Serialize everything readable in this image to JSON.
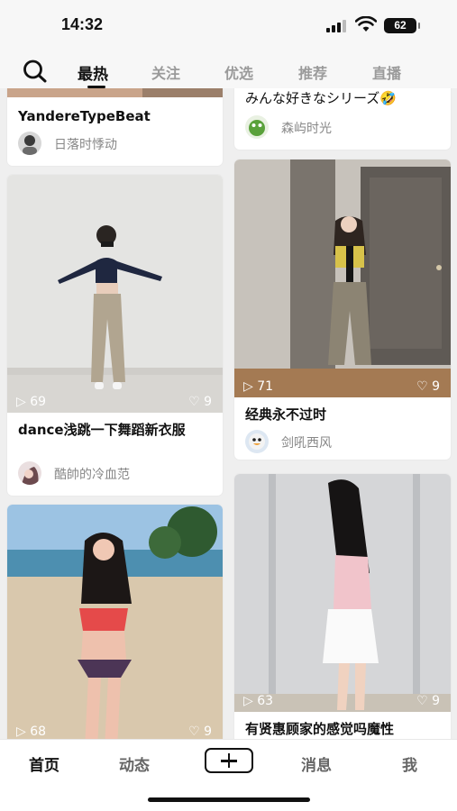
{
  "status_bar": {
    "time": "14:32",
    "battery": "62"
  },
  "top_tabs": [
    {
      "label": "最热",
      "active": true
    },
    {
      "label": "关注",
      "active": false
    },
    {
      "label": "优选",
      "active": false
    },
    {
      "label": "推荐",
      "active": false
    },
    {
      "label": "直播",
      "active": false
    }
  ],
  "feed": {
    "left_column": [
      {
        "title": "YandereTypeBeat",
        "author": "日落时悸动"
      },
      {
        "title": "dance浅跳一下舞蹈新衣服",
        "author": "酷帥的冷血范",
        "plays": "69",
        "likes": "9"
      },
      {
        "plays": "68",
        "likes": "9"
      }
    ],
    "right_column": [
      {
        "title": "みんな好きなシリーズ🤣",
        "author": "森屿时光"
      },
      {
        "title": "经典永不过时",
        "author": "剑吼西风",
        "plays": "71",
        "likes": "9"
      },
      {
        "title": "有贤惠顾家的感觉吗魔性",
        "plays": "63",
        "likes": "9"
      }
    ]
  },
  "bottom_nav": [
    {
      "label": "首页",
      "active": true
    },
    {
      "label": "动态",
      "active": false
    },
    {
      "label": "消息",
      "active": false
    },
    {
      "label": "我",
      "active": false
    }
  ],
  "icons": {
    "search": "search-icon",
    "play": "play-icon",
    "like": "heart-icon",
    "publish": "plus-icon"
  }
}
